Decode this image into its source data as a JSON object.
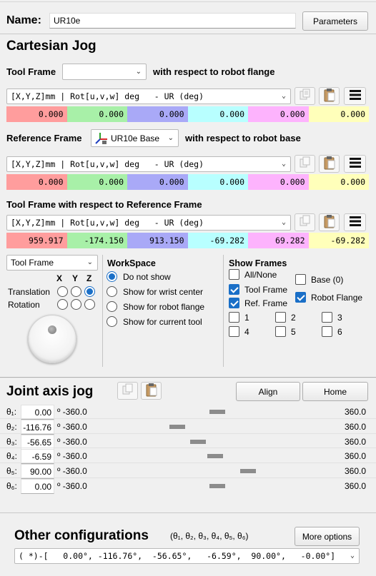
{
  "header": {
    "name_label": "Name:",
    "name_value": "UR10e",
    "parameters_button": "Parameters"
  },
  "cartesian": {
    "title": "Cartesian Jog",
    "tool_frame_label": "Tool Frame",
    "tool_frame_value": "",
    "tool_frame_suffix": "with respect to robot flange",
    "format_combo": "[X,Y,Z]mm | Rot[u,v,w] deg   - UR (deg)",
    "row1": [
      "0.000",
      "0.000",
      "0.000",
      "0.000",
      "0.000",
      "0.000"
    ],
    "reference_frame_label": "Reference Frame",
    "reference_frame_value": "UR10e Base",
    "reference_frame_suffix": "with respect to robot base",
    "row2": [
      "0.000",
      "0.000",
      "0.000",
      "0.000",
      "0.000",
      "0.000"
    ],
    "tool_wrt_ref_label": "Tool Frame with respect to Reference Frame",
    "row3": [
      "959.917",
      "-174.150",
      "913.150",
      "-69.282",
      "69.282",
      "-69.282"
    ],
    "colors": [
      "#ff9d9d",
      "#a8f0a8",
      "#a9a9f7",
      "#b8ffff",
      "#fdb3fd",
      "#ffffba"
    ]
  },
  "jog_panel": {
    "frame_select": "Tool Frame",
    "axes": [
      "X",
      "Y",
      "Z"
    ],
    "translation_label": "Translation",
    "rotation_label": "Rotation",
    "translation_selected_axis": "Z"
  },
  "workspace": {
    "title": "WorkSpace",
    "options": [
      "Do not show",
      "Show for wrist center",
      "Show for robot flange",
      "Show for current tool"
    ],
    "selected": "Do not show"
  },
  "show_frames": {
    "title": "Show Frames",
    "all_none": "All/None",
    "tool_frame": "Tool Frame",
    "ref_frame": "Ref. Frame",
    "base": "Base (0)",
    "robot_flange": "Robot Flange",
    "numbers": [
      "1",
      "2",
      "3",
      "4",
      "5",
      "6"
    ],
    "checked": [
      "Tool Frame",
      "Ref. Frame",
      "Robot Flange"
    ]
  },
  "joint_jog": {
    "title": "Joint axis jog",
    "align_button": "Align",
    "home_button": "Home",
    "joints": [
      {
        "label": "θ₁:",
        "value": "0.00",
        "min": "º -360.0",
        "max": "360.0",
        "fraction": 0.5
      },
      {
        "label": "θ₂:",
        "value": "-116.76",
        "min": "º -360.0",
        "max": "360.0",
        "fraction": 0.338
      },
      {
        "label": "θ₃:",
        "value": "-56.65",
        "min": "º -360.0",
        "max": "360.0",
        "fraction": 0.421
      },
      {
        "label": "θ₄:",
        "value": "-6.59",
        "min": "º -360.0",
        "max": "360.0",
        "fraction": 0.491
      },
      {
        "label": "θ₅:",
        "value": "90.00",
        "min": "º -360.0",
        "max": "360.0",
        "fraction": 0.625
      },
      {
        "label": "θ₆:",
        "value": "0.00",
        "min": "º -360.0",
        "max": "360.0",
        "fraction": 0.5
      }
    ]
  },
  "other_configs": {
    "title": "Other configurations",
    "subtitle": "(θ₁, θ₂, θ₃, θ₄, θ₅, θ₆)",
    "more_options_button": "More options",
    "combo_value": "( *)-[   0.00°, -116.76°,  -56.65°,   -6.59°,  90.00°,   -0.00°]"
  }
}
